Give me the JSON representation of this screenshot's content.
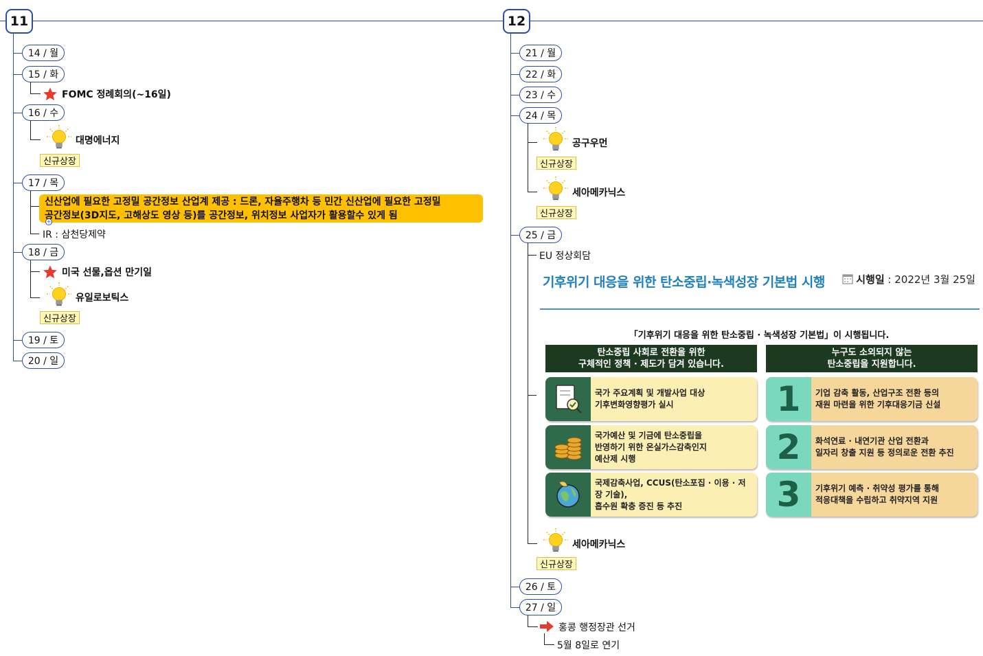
{
  "weeks": [
    {
      "label": "11"
    },
    {
      "label": "12"
    }
  ],
  "week11": {
    "days": [
      "14 / 월",
      "15 / 화",
      "16 / 수",
      "17 / 목",
      "18 / 금",
      "19 / 토",
      "20 / 일"
    ],
    "fomc": "FOMC 정례회의(~16일)",
    "daemyung": "대명에너지",
    "tag_new_listing": "신규상장",
    "highlight_line1": "신산업에 필요한 고정밀 공간정보 산업계 제공 : 드론, 자율주행차 등 민간 신산업에 필요한 고정밀",
    "highlight_line2": "공간정보(3D지도, 고해상도 영상 등)를 공간정보, 위치정보 사업자가 활용할수 있게 됨",
    "ir": "IR : 삼천당제약",
    "us_futures": "미국 선물,옵션 만기일",
    "yuil": "유일로보틱스"
  },
  "week12": {
    "days": [
      "21 / 월",
      "22 / 화",
      "23 / 수",
      "24 / 목",
      "25 / 금",
      "26 / 토",
      "27 / 일"
    ],
    "gonggu": "공구우먼",
    "seah": "세아메카닉스",
    "eu": "EU 정상회담",
    "hongkong": "홍콩 행정장관 선거",
    "postponed": "5월 8일로 연기"
  },
  "infographic": {
    "title": "기후위기 대응을 위한 탄소중립·녹색성장 기본법 시행",
    "date_label": "시행일",
    "date_value": " : 2022년 3월 25일",
    "subtitle": "「기후위기 대응을 위한 탄소중립 · 녹색성장 기본법」이 시행됩니다.",
    "left_head_1": "탄소중립 사회로 전환을 위한",
    "left_head_2": "구체적인 정책 · 제도가 담겨 있습니다.",
    "right_head_1": "누구도 소외되지 않는",
    "right_head_2": "탄소중립을 지원합니다.",
    "left_items": [
      {
        "l1": "국가 주요계획 및 개발사업 대상",
        "l2": "기후변화영향평가 실시",
        "l3": ""
      },
      {
        "l1": "국가예산 및 기금에 탄소중립을",
        "l2": "반영하기 위한 온실가스감축인지",
        "l3": "예산제 시행"
      },
      {
        "l1": "국제감축사업, CCUS(탄소포집 · 이용 · 저장 기술),",
        "l2": "흡수원 확충 증진 등 추진",
        "l3": ""
      }
    ],
    "right_items": [
      {
        "num": "1",
        "l1": "기업 감축 활동, 산업구조 전환 등의",
        "l2": "재원 마련을 위한 기후대응기금 신설"
      },
      {
        "num": "2",
        "l1": "화석연료 · 내연기관 산업 전환과",
        "l2": "일자리 창출 지원 등 정의로운 전환 추진"
      },
      {
        "num": "3",
        "l1": "기후위기 예측 · 취약성 평가를 통해",
        "l2": "적응대책을 수립하고 취약지역 지원"
      }
    ]
  },
  "colors": {
    "line": "#2b4da8",
    "highlight": "#ffc000",
    "tag_bg": "#fff7b8",
    "star": "#e53b2c",
    "arrow": "#e53b2c",
    "bulb": "#ffd21f"
  }
}
